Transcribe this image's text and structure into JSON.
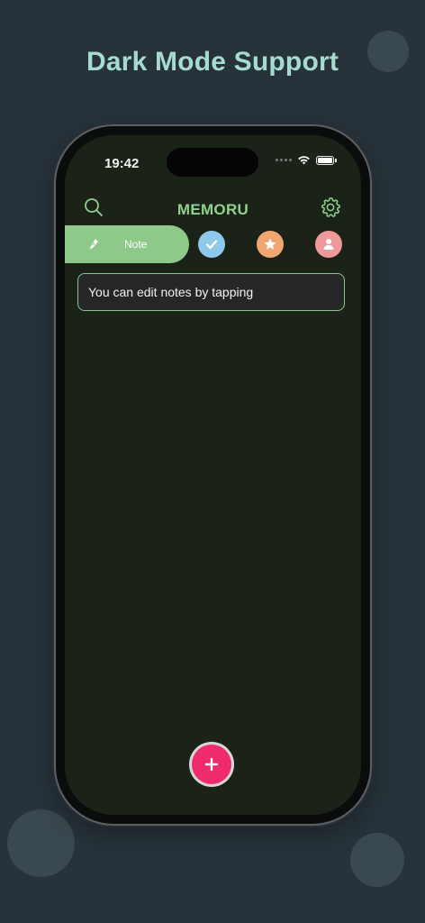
{
  "headline": "Dark Mode Support",
  "status_bar": {
    "time": "19:42"
  },
  "header": {
    "title": "MEMORU",
    "search_icon": "search-icon",
    "settings_icon": "gear-icon"
  },
  "tabs": [
    {
      "label": "Note",
      "icon": "pen-nib-icon",
      "color": "#8fc98a",
      "active": true
    },
    {
      "label": "",
      "icon": "checkmark-icon",
      "color": "#8ec8ea",
      "active": false
    },
    {
      "label": "",
      "icon": "star-icon",
      "color": "#f2a772",
      "active": false
    },
    {
      "label": "",
      "icon": "person-icon",
      "color": "#ee9a9a",
      "active": false
    }
  ],
  "notes": [
    {
      "text": "You can edit notes by tapping"
    }
  ],
  "fab": {
    "icon": "plus-icon",
    "color": "#ef2b6d"
  },
  "colors": {
    "background": "#27323a",
    "headline": "#a6dccd",
    "screen": "#1b2319",
    "accent_green": "#8fd18f"
  }
}
